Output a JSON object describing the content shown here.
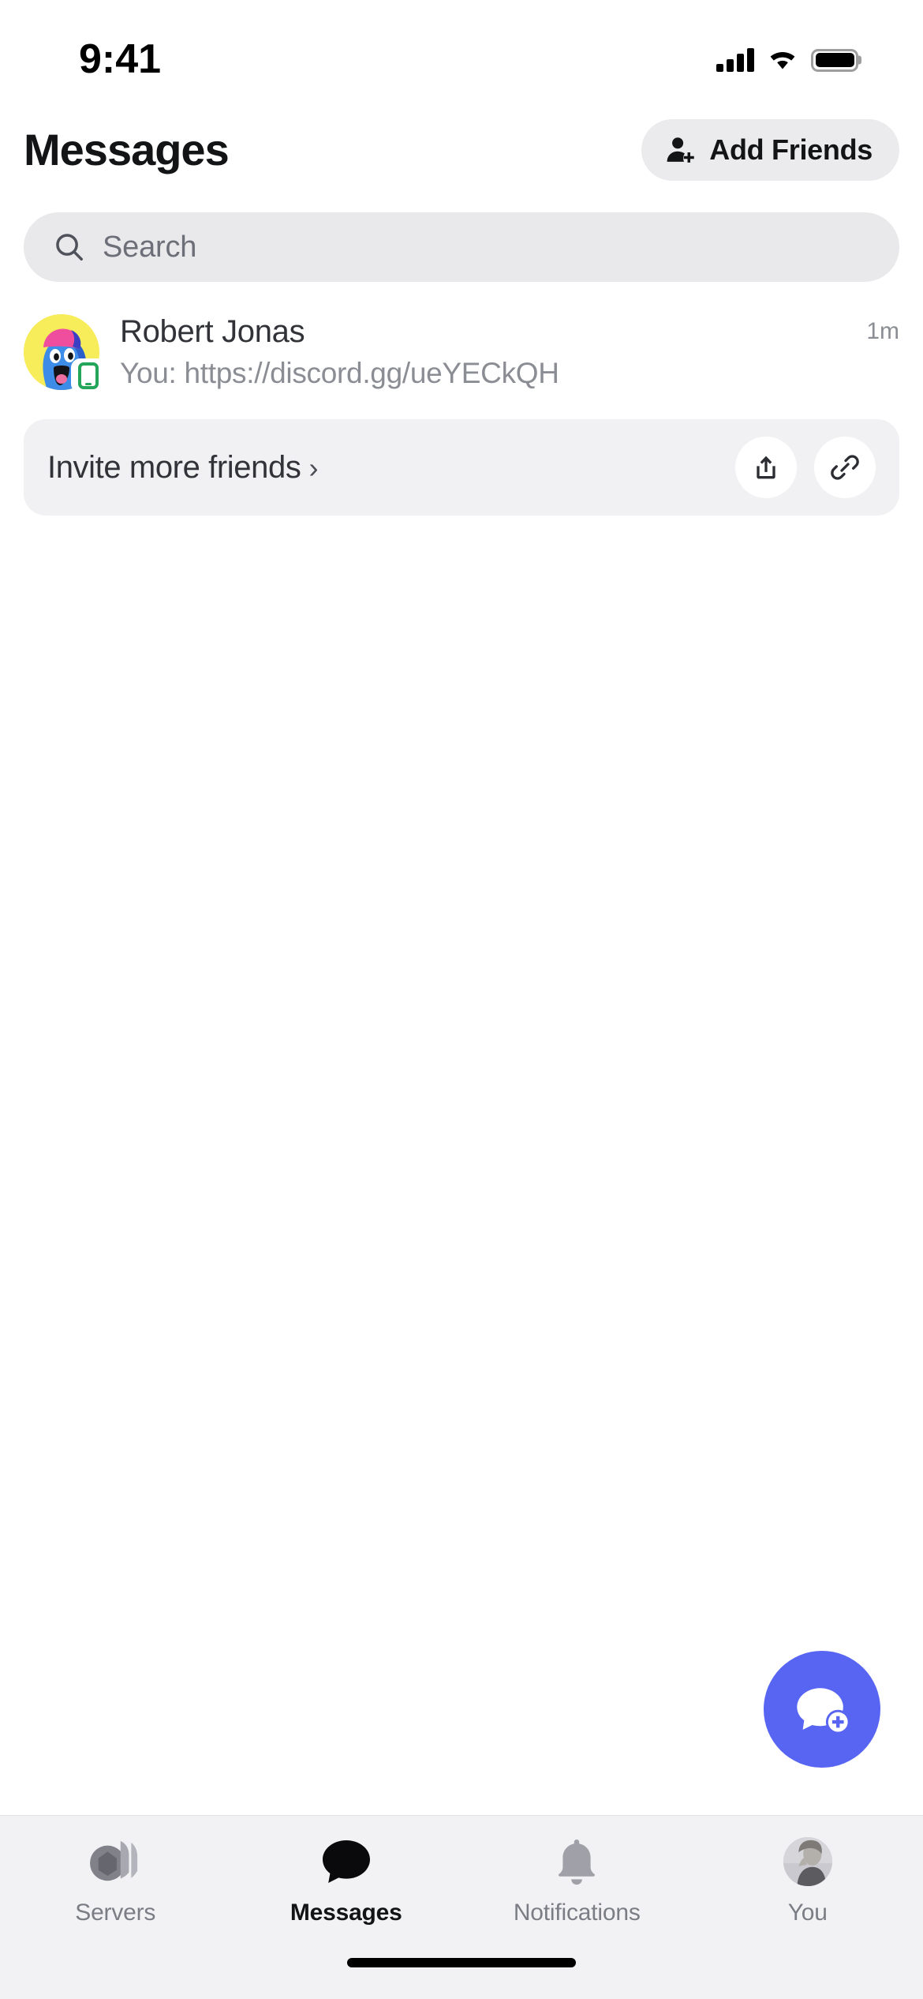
{
  "status_bar": {
    "time": "9:41",
    "signal_icon": "cellular-signal-icon",
    "wifi_icon": "wifi-icon",
    "battery_icon": "battery-icon"
  },
  "header": {
    "title": "Messages",
    "add_friends_label": "Add Friends",
    "add_friends_icon": "person-add-icon"
  },
  "search": {
    "placeholder": "Search",
    "value": "",
    "icon": "search-icon"
  },
  "conversations": [
    {
      "name": "Robert Jonas",
      "preview": "You: https://discord.gg/ueYECkQH",
      "time": "1m",
      "avatar_bg": "#f7ec5a",
      "presence": "mobile-online",
      "presence_color": "#23a55a"
    }
  ],
  "invite_card": {
    "label": "Invite more friends",
    "chevron": "›",
    "share_icon": "share-upload-icon",
    "link_icon": "link-icon"
  },
  "fab": {
    "icon": "new-message-icon",
    "color": "#5865f2"
  },
  "tabbar": {
    "items": [
      {
        "label": "Servers",
        "icon": "servers-icon",
        "active": false
      },
      {
        "label": "Messages",
        "icon": "chat-bubble-icon",
        "active": true
      },
      {
        "label": "Notifications",
        "icon": "bell-icon",
        "active": false
      },
      {
        "label": "You",
        "icon": "user-avatar-icon",
        "active": false
      }
    ]
  },
  "colors": {
    "accent": "#5865f2",
    "surface": "#ffffff",
    "muted_surface": "#e9e9ec",
    "card_surface": "#f1f1f4",
    "tabbar_surface": "#f2f2f5",
    "text_primary": "#313338",
    "text_secondary": "#8b8d94"
  }
}
